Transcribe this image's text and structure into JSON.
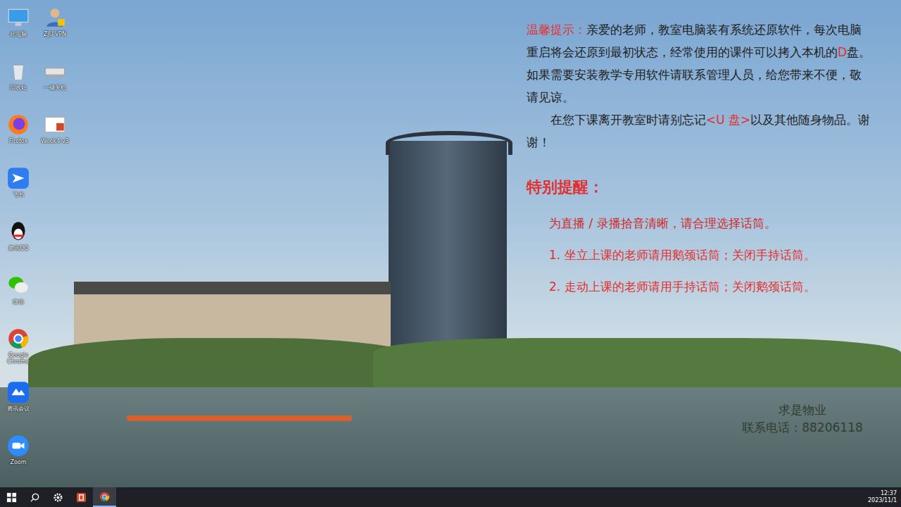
{
  "desktop": {
    "icons": [
      {
        "label": "此电脑",
        "kind": "pc"
      },
      {
        "label": "回收站",
        "kind": "recycle"
      },
      {
        "label": "Firefox",
        "kind": "firefox"
      },
      {
        "label": "飞书",
        "kind": "feishu"
      },
      {
        "label": "腾讯QQ",
        "kind": "qq"
      },
      {
        "label": "微信",
        "kind": "wechat"
      },
      {
        "label": "Google Chrome",
        "kind": "chrome"
      },
      {
        "label": "腾讯会议",
        "kind": "meeting"
      },
      {
        "label": "Zoom",
        "kind": "zoom"
      },
      {
        "label": "ZJU VPN",
        "kind": "vpn"
      },
      {
        "label": "一键关机",
        "kind": "shutdown"
      },
      {
        "label": "Week4-v3",
        "kind": "doc"
      }
    ]
  },
  "wallpaper": {
    "notice": {
      "paragraphs": [
        [
          {
            "text": "温馨提示：",
            "highlight": true
          },
          {
            "text": "亲爱的老师，教室电脑装有系统还原软件，每次电脑重启将会还原到最初状态，经常使用的课件可以拷入本机的",
            "highlight": false
          },
          {
            "text": "D",
            "highlight": true
          },
          {
            "text": "盘。如果需要安装教学专用软件请联系管理人员，给您带来不便，敬请见谅。",
            "highlight": false
          }
        ],
        [
          {
            "text": "在您下课离开教室时请别忘记",
            "highlight": false
          },
          {
            "text": "<U 盘>",
            "highlight": true
          },
          {
            "text": "以及其他随身物品。谢谢！",
            "highlight": false
          }
        ]
      ],
      "special_title": "特别提醒：",
      "special_lines": [
        "为直播 / 录播拾音清晰，请合理选择话筒。",
        "1. 坐立上课的老师请用鹅颈话筒；关闭手持话筒。",
        "2. 走动上课的老师请用手持话筒；关闭鹅颈话筒。"
      ]
    },
    "company": "求是物业",
    "phone": "联系电话：88206118"
  },
  "taskbar": {
    "items": [
      {
        "kind": "start",
        "selected": false
      },
      {
        "kind": "search",
        "selected": false
      },
      {
        "kind": "settings",
        "selected": false
      },
      {
        "kind": "powerpoint",
        "selected": false
      },
      {
        "kind": "chrome",
        "selected": true
      }
    ],
    "time": "12:37",
    "date": "2023/11/1"
  }
}
